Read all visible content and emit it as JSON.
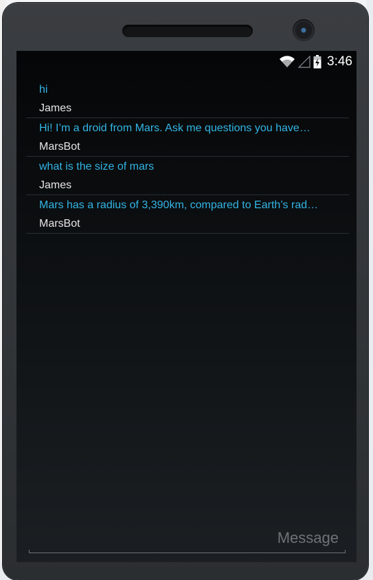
{
  "status_bar": {
    "time": "3:46",
    "icons": [
      "wifi-icon",
      "signal-icon",
      "battery-charging-icon"
    ]
  },
  "messages": [
    {
      "text": "hi",
      "author": "James"
    },
    {
      "text": "Hi! I’m a droid from Mars. Ask me questions you have…",
      "author": "MarsBot"
    },
    {
      "text": "what is the size of mars",
      "author": "James"
    },
    {
      "text": "Mars has a radius of 3,390km, compared to Earth’s rad…",
      "author": "MarsBot"
    }
  ],
  "compose": {
    "placeholder": "Message",
    "value": ""
  },
  "colors": {
    "message_text": "#33b5e5",
    "author_text": "#e6e6e6",
    "screen_bg": "#0d1012",
    "divider": "#2a2e33"
  }
}
